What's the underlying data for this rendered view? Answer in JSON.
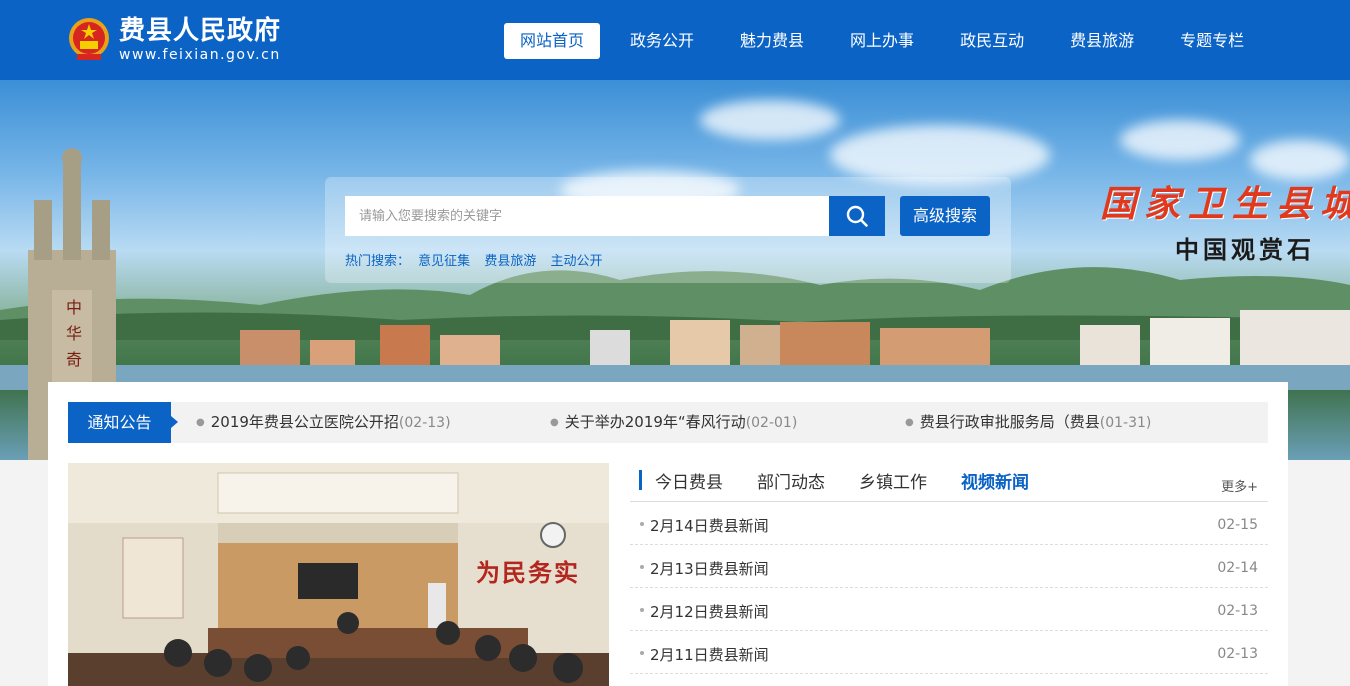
{
  "header": {
    "site_title": "费县人民政府",
    "site_url": "www.feixian.gov.cn",
    "brand_color": "#0b63c6",
    "nav": [
      {
        "label": "网站首页",
        "active": true
      },
      {
        "label": "政务公开"
      },
      {
        "label": "魅力费县"
      },
      {
        "label": "网上办事"
      },
      {
        "label": "政民互动"
      },
      {
        "label": "费县旅游"
      },
      {
        "label": "专题专栏"
      }
    ]
  },
  "banner": {
    "slogan_1": "国家卫生县城",
    "slogan_2": "中国观赏石",
    "tower_text": "中华奇"
  },
  "search": {
    "placeholder": "请输入您要搜索的关键字",
    "search_icon": "search-icon",
    "advanced_label": "高级搜索",
    "hot_label": "热门搜索：",
    "hot_items": [
      "意见征集",
      "费县旅游",
      "主动公开"
    ]
  },
  "notice": {
    "tag": "通知公告",
    "items": [
      {
        "title": "2019年费县公立医院公开招",
        "date": "(02-13)"
      },
      {
        "title": "关于举办2019年“春风行动",
        "date": "(02-01)"
      },
      {
        "title": "费县行政审批服务局（费县",
        "date": "(01-31)"
      }
    ]
  },
  "photo": {
    "wall_text": "为民务实"
  },
  "news": {
    "tabs": [
      {
        "label": "今日费县"
      },
      {
        "label": "部门动态"
      },
      {
        "label": "乡镇工作"
      },
      {
        "label": "视频新闻",
        "active": true
      }
    ],
    "more": "更多+",
    "rows": [
      {
        "title": "2月14日费县新闻",
        "date": "02-15"
      },
      {
        "title": "2月13日费县新闻",
        "date": "02-14"
      },
      {
        "title": "2月12日费县新闻",
        "date": "02-13"
      },
      {
        "title": "2月11日费县新闻",
        "date": "02-13"
      }
    ]
  }
}
